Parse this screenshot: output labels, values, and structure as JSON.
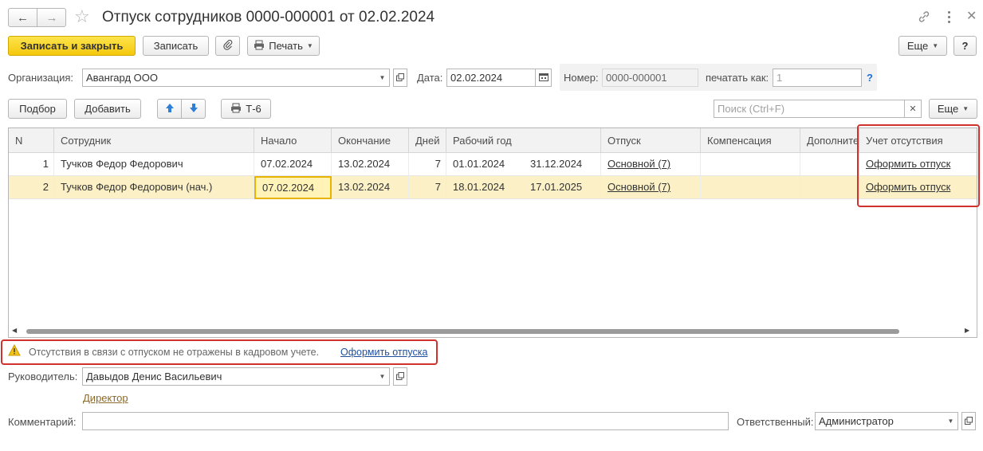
{
  "window": {
    "title": "Отпуск сотрудников 0000-000001 от 02.02.2024"
  },
  "toolbar": {
    "save_close": "Записать и закрыть",
    "save": "Записать",
    "print": "Печать",
    "more": "Еще",
    "help": "?"
  },
  "header": {
    "org_label": "Организация:",
    "org_value": "Авангард ООО",
    "date_label": "Дата:",
    "date_value": "02.02.2024",
    "number_label": "Номер:",
    "number_value": "0000-000001",
    "print_as_label": "печатать как:",
    "print_as_placeholder": "1",
    "print_as_help": "?"
  },
  "table_toolbar": {
    "pick": "Подбор",
    "add": "Добавить",
    "t6": "Т-6",
    "search_placeholder": "Поиск (Ctrl+F)",
    "more": "Еще"
  },
  "table": {
    "columns": [
      "N",
      "Сотрудник",
      "Начало",
      "Окончание",
      "Дней",
      "Рабочий год",
      "Отпуск",
      "Компенсация",
      "Дополнител",
      "Учет отсутствия"
    ],
    "rows": [
      {
        "n": "1",
        "employee": "Тучков Федор Федорович",
        "start": "07.02.2024",
        "end": "13.02.2024",
        "days": "7",
        "year_from": "01.01.2024",
        "year_to": "31.12.2024",
        "vacation": "Основной (7)",
        "compensation": "",
        "additional": "",
        "absence": "Оформить отпуск"
      },
      {
        "n": "2",
        "employee": "Тучков Федор Федорович (нач.)",
        "start": "07.02.2024",
        "end": "13.02.2024",
        "days": "7",
        "year_from": "18.01.2024",
        "year_to": "17.01.2025",
        "vacation": "Основной (7)",
        "compensation": "",
        "additional": "",
        "absence": "Оформить отпуск"
      }
    ]
  },
  "warning": {
    "text": "Отсутствия в связи с отпуском не отражены в кадровом учете.",
    "link": "Оформить отпуска"
  },
  "footer": {
    "manager_label": "Руководитель:",
    "manager_value": "Давыдов Денис Васильевич",
    "manager_position": "Директор",
    "comment_label": "Комментарий:",
    "comment_value": "",
    "responsible_label": "Ответственный:",
    "responsible_value": "Администратор"
  },
  "colors": {
    "accent": "#f5c80d",
    "highlight": "#d0312d",
    "selected_row": "#fbf0c6"
  }
}
